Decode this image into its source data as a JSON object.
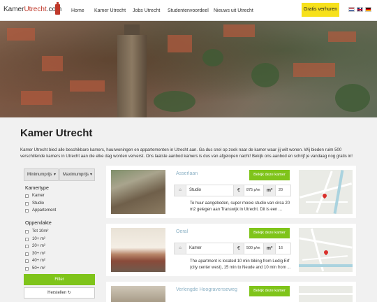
{
  "header": {
    "logo_main": "Kamer",
    "logo_accent": "Utrecht",
    "logo_suffix": ".com",
    "nav": [
      "Home",
      "Kamer Utrecht",
      "Jobs Utrecht",
      "Studentenvoordeel",
      "Nieuws uit Utrecht"
    ],
    "cta_label": "Gratis verhuren",
    "languages": [
      "nl-flag-icon",
      "en-flag-icon",
      "de-flag-icon"
    ]
  },
  "page": {
    "title": "Kamer Utrecht",
    "intro": "Kamer Utrecht bied alle beschikbare kamers, huurwoningen en appartementen in Utrecht aan. Ga dus snel op zoek naar de kamer waar jij wilt wonen. Wij bieden ruim 500 verschillende kamers in Utrecht aan die elke dag worden ververst. Ons laatste aanbod kamers is dus van afgelopen nacht! Bekijk ons aanbod en schrijf je vandaag nog gratis in!"
  },
  "filter": {
    "min_price": "Minimumprijs",
    "max_price": "Maximumprijs",
    "type_heading": "Kamertype",
    "types": [
      "Kamer",
      "Studio",
      "Appartement"
    ],
    "area_heading": "Oppervlakte",
    "areas": [
      "Tot 10m²",
      "10+ m²",
      "20+ m²",
      "30+ m²",
      "40+ m²",
      "50+ m²"
    ],
    "filter_label": "Filter",
    "reset_label": "Herstellen ↻"
  },
  "listings": [
    {
      "name": "Asserlaan",
      "button": "Bekijk deze kamer",
      "type": "Studio",
      "price": "875 p/m",
      "area": "20",
      "description": "Te huur aangeboden, super mooie studio van circa 20 m2 gelegen aan Transwijk in Utrecht. Dit is een ..."
    },
    {
      "name": "Oeral",
      "button": "Bekijk deze kamer",
      "type": "Kamer",
      "price": "500 p/m",
      "area": "16",
      "description": "The apartment is located 10 min biking from Ledig Erf (city center west), 15 min to Neude and 10 min from ..."
    },
    {
      "name": "Verlengde Hoogravenseweg",
      "button": "Bekijk deze kamer"
    }
  ],
  "colors": {
    "accent_green": "#7fc41a",
    "cta_yellow": "#f7e11b",
    "brand_red": "#c0392b"
  }
}
